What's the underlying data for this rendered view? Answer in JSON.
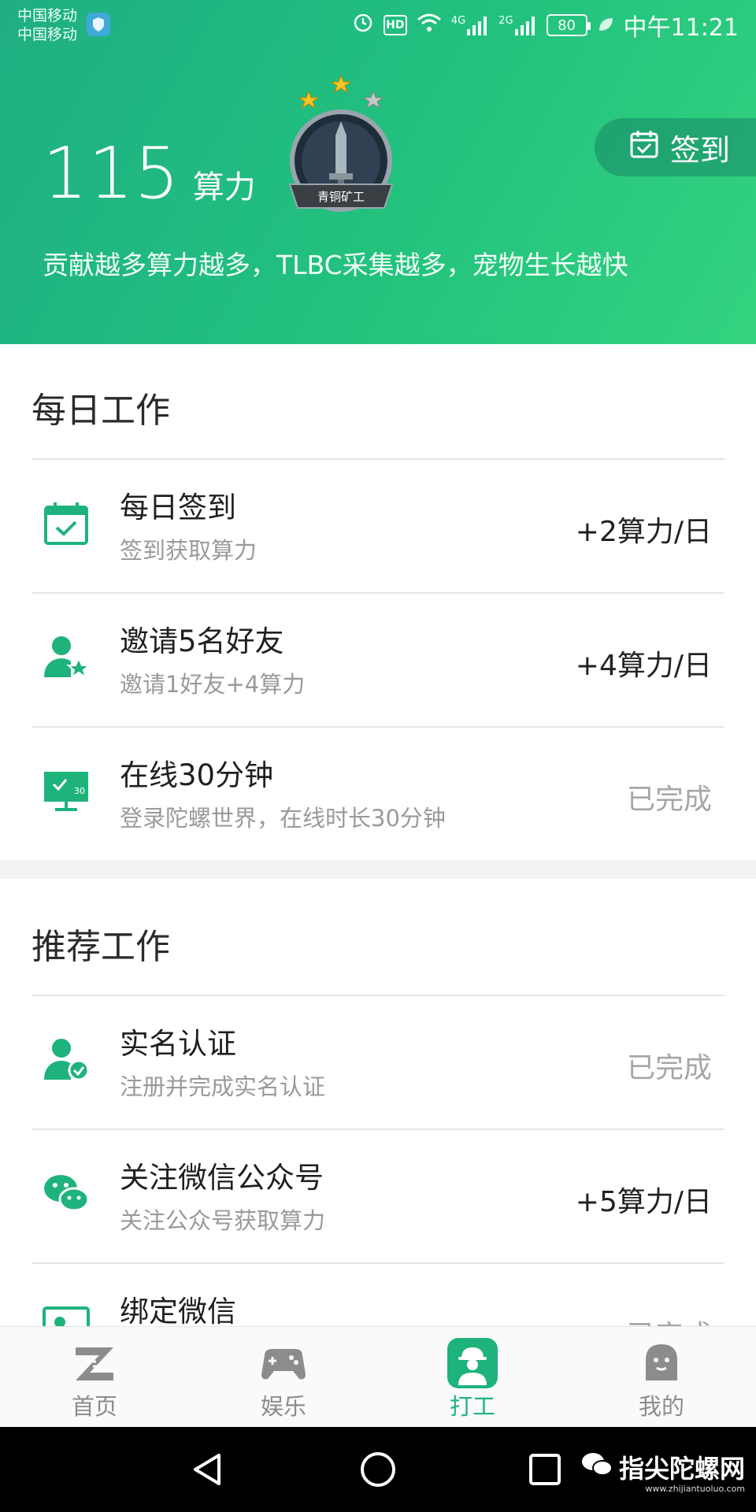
{
  "status_bar": {
    "carrier_1": "中国移动",
    "carrier_2": "中国移动",
    "net1": "4G",
    "net2": "2G",
    "hd": "HD",
    "battery": "80",
    "time": "中午11:21"
  },
  "header": {
    "score_value": "115",
    "score_unit": "算力",
    "badge_label": "青铜矿工",
    "signin_label": "签到",
    "slogan": "贡献越多算力越多，TLBC采集越多，宠物生长越快"
  },
  "daily": {
    "title": "每日工作",
    "items": [
      {
        "title": "每日签到",
        "sub": "签到获取算力",
        "reward": "+2算力/日",
        "icon": "calendar-check-icon"
      },
      {
        "title": "邀请5名好友",
        "sub": "邀请1好友+4算力",
        "reward": "+4算力/日",
        "icon": "user-star-icon"
      },
      {
        "title": "在线30分钟",
        "sub": "登录陀螺世界，在线时长30分钟",
        "reward": "已完成",
        "icon": "monitor-icon"
      }
    ]
  },
  "recommended": {
    "title": "推荐工作",
    "items": [
      {
        "title": "实名认证",
        "sub": "注册并完成实名认证",
        "reward": "已完成",
        "icon": "user-check-icon"
      },
      {
        "title": "关注微信公众号",
        "sub": "关注公众号获取算力",
        "reward": "+5算力/日",
        "icon": "wechat-icon"
      },
      {
        "title": "绑定微信",
        "sub": "",
        "reward": "已完成",
        "icon": "bind-icon"
      }
    ]
  },
  "tabs": [
    {
      "label": "首页",
      "icon": "home-z-icon"
    },
    {
      "label": "娱乐",
      "icon": "gamepad-icon"
    },
    {
      "label": "打工",
      "icon": "worker-icon"
    },
    {
      "label": "我的",
      "icon": "ghost-profile-icon"
    }
  ],
  "watermark": {
    "text": "指尖陀螺网",
    "small": "www.zhijiantuoluo.com"
  },
  "colors": {
    "accent": "#1fb37c",
    "header_start": "#1fae83",
    "header_end": "#34d37f"
  }
}
